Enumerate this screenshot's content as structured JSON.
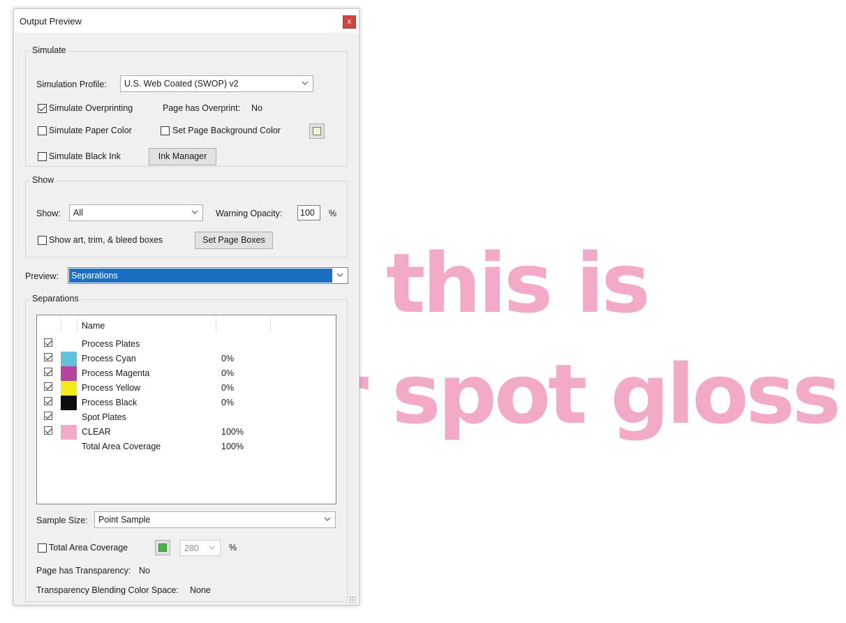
{
  "colors": {
    "art_pink": "#f3a9c8",
    "process_cyan": "#62c2d9",
    "process_magenta": "#b5459a",
    "process_yellow": "#f4ea1a",
    "process_black": "#0d0d0d",
    "clear": "#f3a9c8",
    "paper_color": "#f1f1d4",
    "tac_swatch": "#4cb14a",
    "preview_highlight": "#1b6ec2"
  },
  "artwork": {
    "line1": "this is",
    "line2": "r spot gloss"
  },
  "dialog": {
    "title": "Output Preview",
    "close_glyph": "x",
    "simulate": {
      "group_label": "Simulate",
      "profile_label": "Simulation Profile:",
      "profile_value": "U.S. Web Coated (SWOP) v2",
      "overprinting_label": "Simulate Overprinting",
      "overprinting_checked": true,
      "page_overprint_label": "Page has Overprint:",
      "page_overprint_value": "No",
      "paper_color_label": "Simulate Paper Color",
      "paper_color_checked": false,
      "page_bg_label": "Set Page Background Color",
      "page_bg_checked": false,
      "black_ink_label": "Simulate Black Ink",
      "black_ink_checked": false,
      "ink_manager_label": "Ink Manager"
    },
    "show": {
      "group_label": "Show",
      "show_label": "Show:",
      "show_value": "All",
      "opacity_label": "Warning Opacity:",
      "opacity_value": "100",
      "opacity_unit": "%",
      "boxes_label": "Show art, trim, & bleed boxes",
      "boxes_checked": false,
      "set_boxes_label": "Set Page Boxes"
    },
    "preview": {
      "label": "Preview:",
      "value": "Separations"
    },
    "separations": {
      "group_label": "Separations",
      "name_header": "Name",
      "rows": [
        {
          "checked": true,
          "name": "Process Plates",
          "pct": "",
          "swatch": ""
        },
        {
          "checked": true,
          "name": "Process Cyan",
          "pct": "0%",
          "swatch": "#62c2d9"
        },
        {
          "checked": true,
          "name": "Process Magenta",
          "pct": "0%",
          "swatch": "#b5459a"
        },
        {
          "checked": true,
          "name": "Process Yellow",
          "pct": "0%",
          "swatch": "#f4ea1a"
        },
        {
          "checked": true,
          "name": "Process Black",
          "pct": "0%",
          "swatch": "#0d0d0d"
        },
        {
          "checked": true,
          "name": "Spot Plates",
          "pct": "",
          "swatch": ""
        },
        {
          "checked": true,
          "name": "CLEAR",
          "pct": "100%",
          "swatch": "#f3a9c8"
        },
        {
          "checked": null,
          "name": "Total Area Coverage",
          "pct": "100%",
          "swatch": ""
        }
      ],
      "sample_size_label": "Sample Size:",
      "sample_size_value": "Point Sample",
      "tac_label": "Total Area Coverage",
      "tac_checked": false,
      "tac_value": "280",
      "tac_unit": "%",
      "transparency_label": "Page has Transparency:",
      "transparency_value": "No",
      "blending_label": "Transparency Blending Color Space:",
      "blending_value": "None"
    }
  }
}
